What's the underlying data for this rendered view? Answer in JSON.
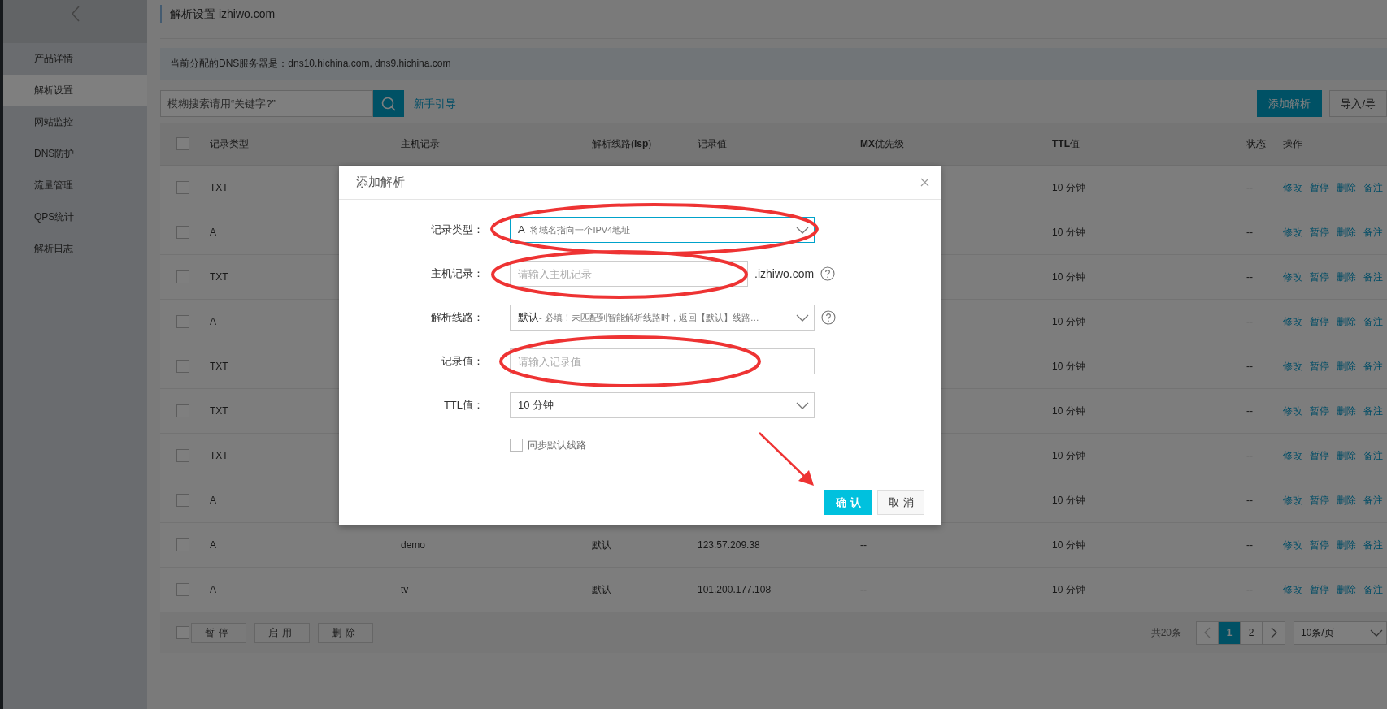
{
  "sidebar": {
    "items": [
      {
        "label": "产品详情",
        "selected": false
      },
      {
        "label": "解析设置",
        "selected": true
      },
      {
        "label": "网站监控",
        "selected": false
      },
      {
        "label": "DNS防护",
        "selected": false
      },
      {
        "label": "流量管理",
        "selected": false
      },
      {
        "label": "QPS统计",
        "selected": false
      },
      {
        "label": "解析日志",
        "selected": false
      }
    ]
  },
  "header": {
    "title": "解析设置 izhiwo.com"
  },
  "dns_notice": "当前分配的DNS服务器是：dns10.hichina.com, dns9.hichina.com",
  "search": {
    "placeholder": "模糊搜索请用“关键字?”"
  },
  "guide_link": "新手引导",
  "toolbar_buttons": [
    {
      "label": "添加解析",
      "kind": "primary"
    },
    {
      "label": "导入/导",
      "kind": "default"
    }
  ],
  "table": {
    "select_all_checked": false,
    "columns": [
      "记录类型",
      "主机记录",
      "解析线路(**isp**)",
      "记录值",
      "**MX**优先级",
      "**TTL**值",
      "状态",
      "操作"
    ],
    "rows": [
      {
        "checked": false,
        "type": "TXT",
        "ttl": "10 分钟",
        "status": "--",
        "actions": [
          "修改",
          "暂停",
          "删除",
          "备注"
        ]
      },
      {
        "checked": false,
        "type": "A",
        "ttl": "10 分钟",
        "status": "--",
        "actions": [
          "修改",
          "暂停",
          "删除",
          "备注"
        ]
      },
      {
        "checked": false,
        "type": "TXT",
        "ttl": "10 分钟",
        "status": "--",
        "actions": [
          "修改",
          "暂停",
          "删除",
          "备注"
        ]
      },
      {
        "checked": false,
        "type": "A",
        "ttl": "10 分钟",
        "status": "--",
        "actions": [
          "修改",
          "暂停",
          "删除",
          "备注"
        ]
      },
      {
        "checked": false,
        "type": "TXT",
        "ttl": "10 分钟",
        "status": "--",
        "actions": [
          "修改",
          "暂停",
          "删除",
          "备注"
        ]
      },
      {
        "checked": false,
        "type": "TXT",
        "ttl": "10 分钟",
        "status": "--",
        "actions": [
          "修改",
          "暂停",
          "删除",
          "备注"
        ]
      },
      {
        "checked": false,
        "type": "TXT",
        "ttl": "10 分钟",
        "status": "--",
        "actions": [
          "修改",
          "暂停",
          "删除",
          "备注"
        ]
      },
      {
        "checked": false,
        "type": "A",
        "ttl": "10 分钟",
        "status": "--",
        "actions": [
          "修改",
          "暂停",
          "删除",
          "备注"
        ]
      },
      {
        "checked": false,
        "type": "A",
        "host": "demo",
        "line": "默认",
        "value": "123.57.209.38",
        "mx": "--",
        "ttl": "10 分钟",
        "status": "--",
        "actions": [
          "修改",
          "暂停",
          "删除",
          "备注"
        ]
      },
      {
        "checked": false,
        "type": "A",
        "host": "tv",
        "line": "默认",
        "value": "101.200.177.108",
        "mx": "--",
        "ttl": "10 分钟",
        "status": "--",
        "actions": [
          "修改",
          "暂停",
          "删除",
          "备注"
        ]
      }
    ]
  },
  "footer": {
    "select_all_checked": false,
    "batch_buttons": [
      "暂停",
      "启用",
      "删除"
    ],
    "total": "共20条",
    "pages": [
      {
        "label": "1",
        "selected": true
      },
      {
        "label": "2",
        "selected": false
      }
    ],
    "page_size": "10条/页"
  },
  "dialog": {
    "title": "添加解析",
    "fields": [
      {
        "kind": "select",
        "label": "记录类型：",
        "value": "A",
        "note": "- 将域名指向一个IPV4地址",
        "focused": true
      },
      {
        "kind": "input",
        "label": "主机记录：",
        "placeholder": "请输入主机记录",
        "suffix": ".izhiwo.com",
        "help": true
      },
      {
        "kind": "select",
        "label": "解析线路：",
        "value": "默认",
        "note": "- 必填！未匹配到智能解析线路时，返回【默认】线路…",
        "help": true
      },
      {
        "kind": "input",
        "label": "记录值：",
        "placeholder": "请输入记录值"
      },
      {
        "kind": "select",
        "label": "TTL值：",
        "value": "10 分钟"
      }
    ],
    "checkbox": {
      "label": "同步默认线路",
      "checked": false
    },
    "buttons": [
      {
        "label": "确认",
        "kind": "primary"
      },
      {
        "label": "取消",
        "kind": "default"
      }
    ]
  }
}
